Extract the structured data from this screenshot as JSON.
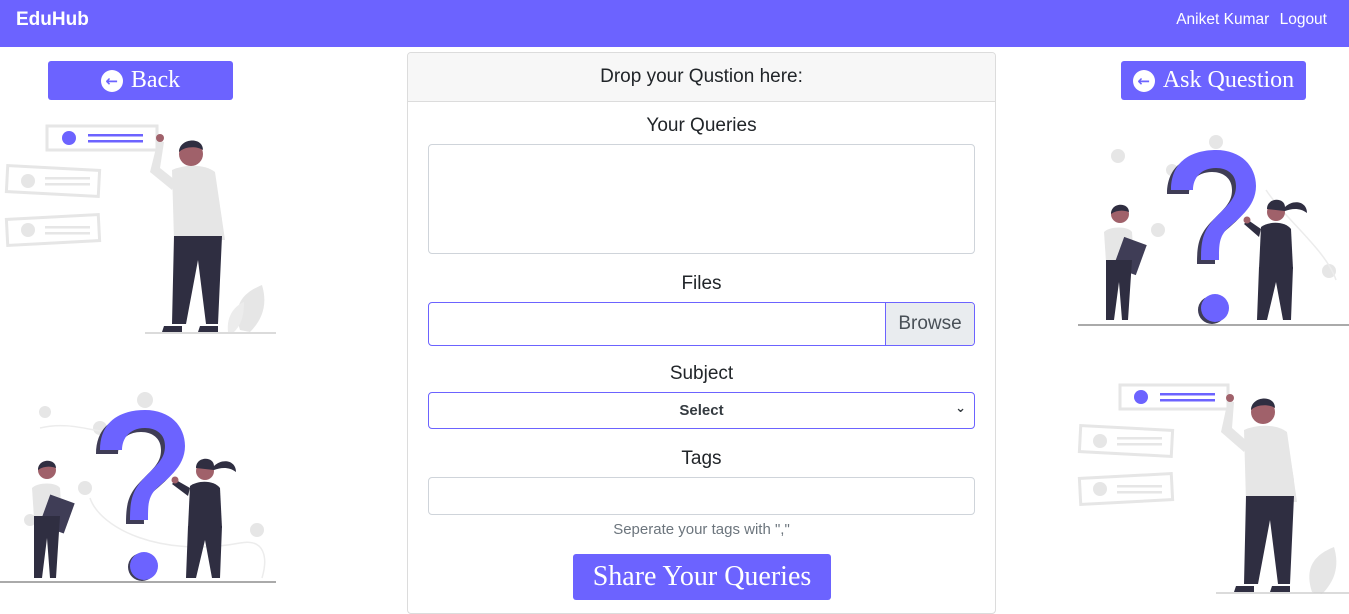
{
  "navbar": {
    "brand": "EduHub",
    "user_name": "Aniket Kumar",
    "logout_label": "Logout"
  },
  "left": {
    "back_label": "Back"
  },
  "right": {
    "ask_label": "Ask Question"
  },
  "form": {
    "header": "Drop your Qustion here:",
    "queries_label": "Your Queries",
    "queries_value": "",
    "files_label": "Files",
    "browse_label": "Browse",
    "subject_label": "Subject",
    "subject_selected": "Select",
    "tags_label": "Tags",
    "tags_value": "",
    "tags_hint": "Seperate your tags with \",\"",
    "submit_label": "Share Your Queries"
  },
  "colors": {
    "accent": "#6c63ff",
    "skin": "#a0616a",
    "dark": "#2f2e41",
    "light_gray": "#e6e6e6"
  },
  "icons": {
    "back": "arrow-left-circle-icon",
    "ask": "arrow-left-circle-icon",
    "dropdown": "chevron-down-icon"
  }
}
